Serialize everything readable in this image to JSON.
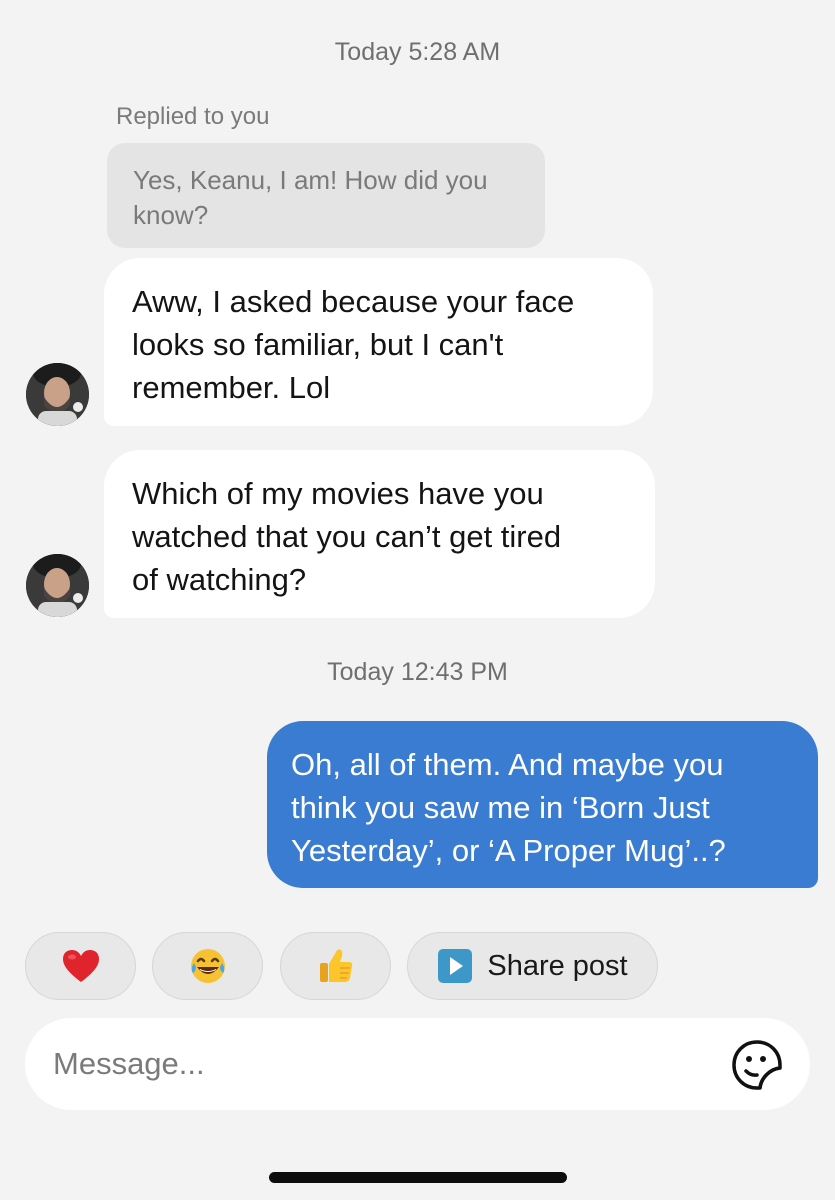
{
  "conversation": {
    "timestamp_1": "Today 5:28 AM",
    "reply_context": {
      "label": "Replied to you",
      "quoted_text": "Yes, Keanu, I am! How did you know?"
    },
    "incoming_1": {
      "line_1": "Aww, I asked because your face",
      "line_2": "looks so familiar, but I can't",
      "line_3": "remember. Lol"
    },
    "incoming_2": {
      "line_1": "Which of my movies have you",
      "line_2": "watched that you can’t get tired",
      "line_3": "of watching?"
    },
    "timestamp_2": "Today 12:43 PM",
    "outgoing_1": {
      "line_1": "Oh, all of them. And maybe you",
      "line_2": "think you saw me in ‘Born Just",
      "line_3": "Yesterday’, or ‘A Proper Mug’..?"
    }
  },
  "quick_reactions": {
    "items": [
      {
        "icon": "heart-emoji"
      },
      {
        "icon": "tears-of-joy-emoji"
      },
      {
        "icon": "thumbs-up-emoji"
      }
    ],
    "share": {
      "icon": "play-icon",
      "label": "Share post"
    }
  },
  "composer": {
    "placeholder": "Message...",
    "sticker_icon": "sticker-icon"
  },
  "colors": {
    "background": "#f3f3f3",
    "incoming_bubble": "#ffffff",
    "outgoing_bubble": "#3a7cd2",
    "quoted_bubble": "#e4e4e4",
    "share_play_icon": "#3d97c8"
  }
}
